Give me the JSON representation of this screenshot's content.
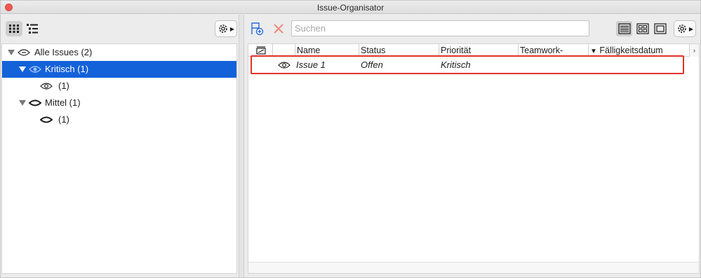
{
  "window": {
    "title": "Issue-Organisator"
  },
  "left_toolbar": {
    "view_buttons": [
      {
        "icon": "grid-dots-icon",
        "active": true
      },
      {
        "icon": "tree-list-icon",
        "active": false
      }
    ],
    "settings_icon": "gear-icon"
  },
  "tree": {
    "items": [
      {
        "label": "Alle Issues (2)",
        "expanded": true,
        "icon": "eye-outline-icon",
        "level": 0
      },
      {
        "label": "Kritisch (1)",
        "expanded": true,
        "icon": "eye-blue-icon",
        "level": 1,
        "selected": true
      },
      {
        "label": "(1)",
        "icon": "eye-outline-icon",
        "level": 2
      },
      {
        "label": "Mittel (1)",
        "expanded": true,
        "icon": "eye-closed-icon",
        "level": 1
      },
      {
        "label": "(1)",
        "icon": "eye-closed-icon",
        "level": 2
      }
    ]
  },
  "right_toolbar": {
    "new_issue_icon": "new-issue-icon",
    "delete_icon": "delete-x-icon",
    "search": {
      "placeholder": "Suchen",
      "value": ""
    },
    "view_modes": [
      {
        "icon": "list-view-icon",
        "active": true
      },
      {
        "icon": "grid-view-icon",
        "active": false
      },
      {
        "icon": "single-view-icon",
        "active": false
      }
    ]
  },
  "table": {
    "columns": [
      "",
      "",
      "Name",
      "Status",
      "Priorität",
      "Teamwork-",
      "Fälligkeitsdatum"
    ],
    "sort_indicator": "▼",
    "rows": [
      {
        "name": "Issue 1",
        "status": "Offen",
        "priority": "Kritisch",
        "teamwork": "",
        "due": ""
      }
    ]
  },
  "colors": {
    "selection": "#1462d9",
    "highlight_outline": "#e0322a",
    "delete_icon": "#f08a80",
    "new_issue_icon": "#2a6cd9"
  }
}
